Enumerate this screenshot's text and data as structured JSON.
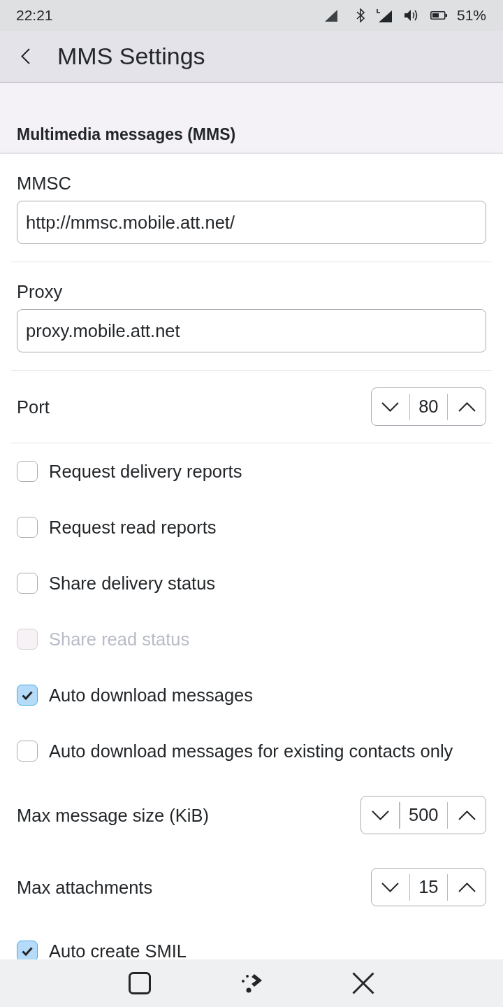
{
  "status_bar": {
    "time": "22:21",
    "battery": "51%"
  },
  "header": {
    "title": "MMS Settings"
  },
  "section": {
    "title": "Multimedia messages (MMS)",
    "groups": [
      {
        "items": [
          {
            "kind": "text",
            "label": "MMSC",
            "value": "http://mmsc.mobile.att.net/"
          }
        ]
      },
      {
        "items": [
          {
            "kind": "text",
            "label": "Proxy",
            "value": "proxy.mobile.att.net"
          }
        ]
      },
      {
        "items": [
          {
            "kind": "spin",
            "label": "Port",
            "value": "80"
          }
        ]
      },
      {
        "items": [
          {
            "kind": "check",
            "label": "Request delivery reports",
            "checked": false,
            "disabled": false
          },
          {
            "kind": "check",
            "label": "Request read reports",
            "checked": false,
            "disabled": false
          },
          {
            "kind": "check",
            "label": "Share delivery status",
            "checked": false,
            "disabled": false
          },
          {
            "kind": "check",
            "label": "Share read status",
            "checked": false,
            "disabled": true
          },
          {
            "kind": "check",
            "label": "Auto download messages",
            "checked": true,
            "disabled": false
          },
          {
            "kind": "check",
            "label": "Auto download messages for existing contacts only",
            "checked": false,
            "disabled": false
          },
          {
            "kind": "spin",
            "label": "Max message size (KiB)",
            "value": "500"
          },
          {
            "kind": "spin",
            "label": "Max attachments",
            "value": "15"
          },
          {
            "kind": "check",
            "label": "Auto create SMIL",
            "checked": true,
            "disabled": false
          }
        ]
      }
    ]
  }
}
